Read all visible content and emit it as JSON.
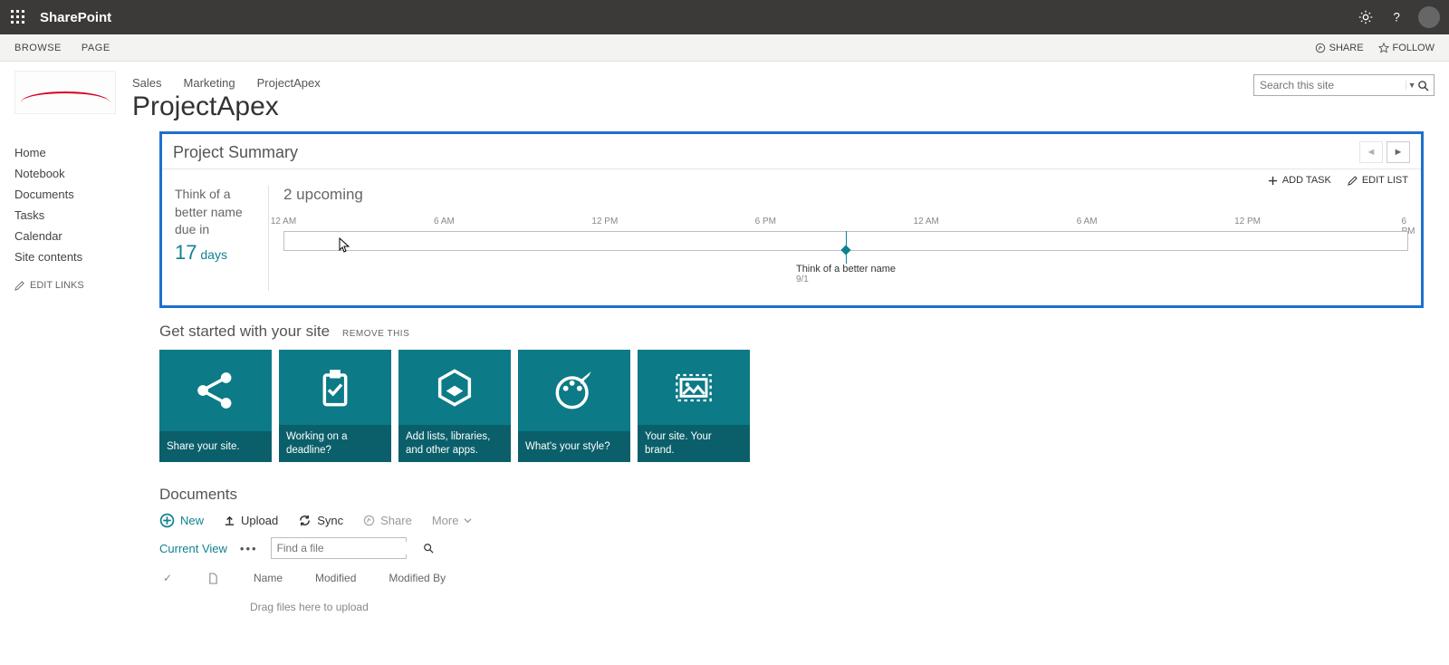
{
  "topbar": {
    "brand": "SharePoint"
  },
  "ribbon": {
    "tabs": [
      "BROWSE",
      "PAGE"
    ],
    "share": "SHARE",
    "follow": "FOLLOW"
  },
  "nav": {
    "items": [
      "Sales",
      "Marketing",
      "ProjectApex"
    ]
  },
  "site_title": "ProjectApex",
  "search": {
    "placeholder": "Search this site"
  },
  "leftnav": {
    "items": [
      "Home",
      "Notebook",
      "Documents",
      "Tasks",
      "Calendar",
      "Site contents"
    ],
    "edit": "EDIT LINKS"
  },
  "project_summary": {
    "title": "Project Summary",
    "card": {
      "line1": "Think of a",
      "line2": "better name",
      "line3": "due in",
      "num": "17",
      "unit": "days"
    },
    "upcoming": "2 upcoming",
    "add_task": "ADD TASK",
    "edit_list": "EDIT LIST",
    "time_labels": [
      "12 AM",
      "6 AM",
      "12 PM",
      "6 PM",
      "12 AM",
      "6 AM",
      "12 PM",
      "6 PM"
    ],
    "marker": {
      "label": "Think of a better name",
      "date": "9/1",
      "percent": 50
    }
  },
  "get_started": {
    "title": "Get started with your site",
    "remove": "REMOVE THIS",
    "tiles": [
      "Share your site.",
      "Working on a deadline?",
      "Add lists, libraries, and other apps.",
      "What's your style?",
      "Your site. Your brand."
    ]
  },
  "documents": {
    "title": "Documents",
    "toolbar": {
      "new": "New",
      "upload": "Upload",
      "sync": "Sync",
      "share": "Share",
      "more": "More"
    },
    "current_view": "Current View",
    "find_placeholder": "Find a file",
    "columns": [
      "Name",
      "Modified",
      "Modified By"
    ],
    "dropzone": "Drag files here to upload"
  }
}
